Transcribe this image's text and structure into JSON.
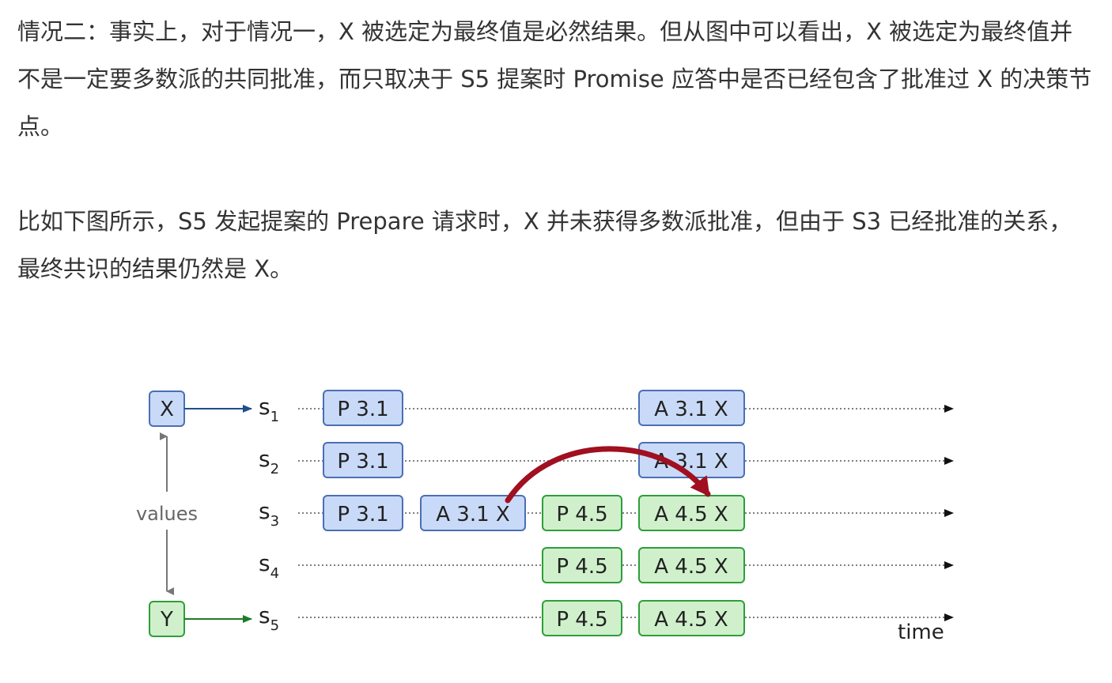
{
  "paragraphs": [
    "情况二：事实上，对于情况一，X 被选定为最终值是必然结果。但从图中可以看出，X 被选定为最终值并不是一定要多数派的共同批准，而只取决于 S5 提案时 Promise 应答中是否已经包含了批准过 X 的决策节点。",
    "比如下图所示，S5 发起提案的 Prepare 请求时，X 并未获得多数派批准，但由于 S3 已经批准的关系，最终共识的结果仍然是 X。"
  ],
  "diagram": {
    "values_label": "values",
    "value_x": "X",
    "value_y": "Y",
    "time_label": "time",
    "lanes": [
      {
        "base": "s",
        "sub": "1",
        "boxes": [
          {
            "text": "P 3.1",
            "color": "blue"
          },
          {
            "text": "A 3.1 X",
            "color": "blue"
          }
        ]
      },
      {
        "base": "s",
        "sub": "2",
        "boxes": [
          {
            "text": "P 3.1",
            "color": "blue"
          },
          {
            "text": "A 3.1 X",
            "color": "blue"
          }
        ]
      },
      {
        "base": "s",
        "sub": "3",
        "boxes": [
          {
            "text": "P 3.1",
            "color": "blue"
          },
          {
            "text": "A 3.1 X",
            "color": "blue"
          },
          {
            "text": "P 4.5",
            "color": "green"
          },
          {
            "text": "A 4.5 X",
            "color": "green"
          }
        ]
      },
      {
        "base": "s",
        "sub": "4",
        "boxes": [
          {
            "text": "P 4.5",
            "color": "green"
          },
          {
            "text": "A 4.5 X",
            "color": "green"
          }
        ]
      },
      {
        "base": "s",
        "sub": "5",
        "boxes": [
          {
            "text": "P 4.5",
            "color": "green"
          },
          {
            "text": "A 4.5 X",
            "color": "green"
          }
        ]
      }
    ],
    "colors": {
      "blue_fill": "#c9daf8",
      "blue_stroke": "#4a6fb5",
      "green_fill": "#d0f0cc",
      "green_stroke": "#2e9e3a",
      "arc": "#a01020"
    }
  }
}
